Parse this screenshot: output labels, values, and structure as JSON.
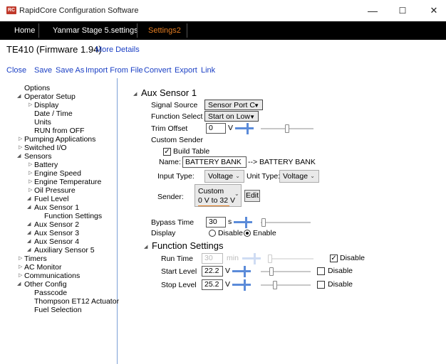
{
  "window": {
    "logo": "RC",
    "title": "RapidCore Configuration Software",
    "minimize_glyph": "—",
    "maximize_glyph": "☐",
    "close_glyph": "✕"
  },
  "tabs": [
    {
      "label": "Home",
      "active": false
    },
    {
      "label": "Yanmar Stage 5.settings",
      "active": false
    },
    {
      "label": "Settings2",
      "active": true
    }
  ],
  "device": {
    "name": "TE410 (Firmware 1.94)",
    "more_details": "More Details"
  },
  "menu": [
    "Close",
    "Save",
    "Save As",
    "Import From File",
    "Convert",
    "Export",
    "Link"
  ],
  "tree": [
    {
      "label": "Options",
      "arrow": ""
    },
    {
      "label": "Operator Setup",
      "arrow": "◢"
    },
    {
      "label": "Display",
      "arrow": "▷"
    },
    {
      "label": "Date / Time",
      "arrow": ""
    },
    {
      "label": "Units",
      "arrow": ""
    },
    {
      "label": "RUN from OFF",
      "arrow": ""
    },
    {
      "label": "Pumping Applications",
      "arrow": "▷"
    },
    {
      "label": "Switched I/O",
      "arrow": "▷"
    },
    {
      "label": "Sensors",
      "arrow": "◢"
    },
    {
      "label": "Battery",
      "arrow": "▷"
    },
    {
      "label": "Engine Speed",
      "arrow": "▷"
    },
    {
      "label": "Engine Temperature",
      "arrow": "▷"
    },
    {
      "label": "Oil Pressure",
      "arrow": "▷"
    },
    {
      "label": "Fuel Level",
      "arrow": "◢"
    },
    {
      "label": "Aux Sensor 1",
      "arrow": "◢"
    },
    {
      "label": "Function Settings",
      "arrow": ""
    },
    {
      "label": "Aux Sensor 2",
      "arrow": "◢"
    },
    {
      "label": "Aux Sensor 3",
      "arrow": "◢"
    },
    {
      "label": "Aux Sensor 4",
      "arrow": "◢"
    },
    {
      "label": "Auxiliary Sensor 5",
      "arrow": "◢"
    },
    {
      "label": "Timers",
      "arrow": "▷"
    },
    {
      "label": "AC Monitor",
      "arrow": "▷"
    },
    {
      "label": "Communications",
      "arrow": "▷"
    },
    {
      "label": "Other Config",
      "arrow": "◢"
    },
    {
      "label": "Passcode",
      "arrow": ""
    },
    {
      "label": "Thompson ET12 Actuator",
      "arrow": ""
    },
    {
      "label": "Fuel Selection",
      "arrow": ""
    }
  ],
  "aux": {
    "section_arrow": "◢",
    "title": "Aux Sensor 1",
    "signal_source": {
      "label": "Signal Source",
      "value": "Sensor Port C"
    },
    "function_select": {
      "label": "Function Select",
      "value": "Start on Low"
    },
    "trim_offset": {
      "label": "Trim Offset",
      "value": "0",
      "unit": "V",
      "slider_fraction": 0.5
    },
    "custom_sender": {
      "label": "Custom Sender",
      "build_table": {
        "label": "Build Table",
        "checked": true,
        "mark": "✓"
      },
      "name_label": "Name:",
      "name_value": "BATTERY BANK",
      "name_result": "--> BATTERY BANK",
      "input_type_label": "Input Type:",
      "input_type": "Voltage",
      "unit_type_label": "Unit Type:",
      "unit_type": "Voltage",
      "sender_label": "Sender:",
      "sender_line1": "Custom",
      "sender_line2": "0 V to 32 V",
      "edit_label": "Edit"
    },
    "bypass_time": {
      "label": "Bypass Time",
      "value": "30",
      "unit": "s",
      "slider_fraction": 0.0
    },
    "display": {
      "label": "Display",
      "options": [
        "Disable",
        "Enable"
      ],
      "selected": "Enable"
    }
  },
  "function_settings": {
    "arrow": "◢",
    "title": "Function Settings",
    "rows": [
      {
        "label": "Run Time",
        "value": "30",
        "unit": "min",
        "enabled": false,
        "slider_fraction": 0.0,
        "disable_label": "Disable",
        "disable_checked": true
      },
      {
        "label": "Start Level",
        "value": "22.2",
        "unit": "V",
        "enabled": true,
        "slider_fraction": 0.18,
        "disable_label": "Disable",
        "disable_checked": false
      },
      {
        "label": "Stop Level",
        "value": "25.2",
        "unit": "V",
        "enabled": true,
        "slider_fraction": 0.28,
        "disable_label": "Disable",
        "disable_checked": false
      }
    ]
  },
  "colors": {
    "tabbar": "#000000",
    "active_tab": "#e67e22",
    "link": "#1a3fc4",
    "accent": "#5b8bd9"
  }
}
